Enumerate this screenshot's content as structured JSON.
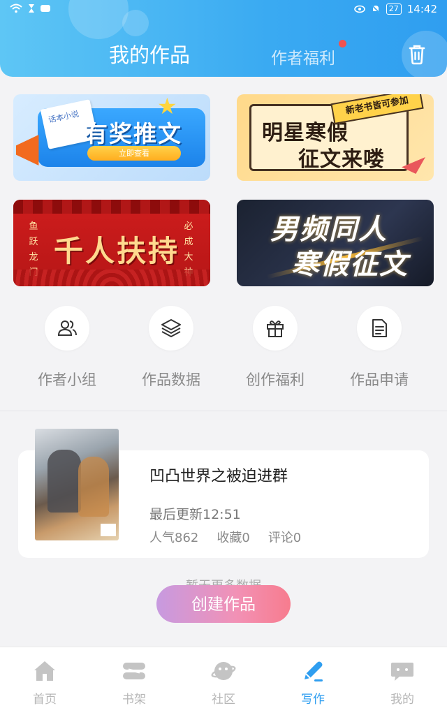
{
  "status_bar": {
    "battery": "27",
    "time": "14:42"
  },
  "header": {
    "tabs": [
      {
        "label": "我的作品",
        "active": true
      },
      {
        "label": "作者福利",
        "active": false,
        "badge_dot": true
      }
    ],
    "trash_icon": "trash-icon"
  },
  "banners": [
    {
      "title": "有奖推文",
      "button": "立即查看",
      "paper_text": "话本小说"
    },
    {
      "title_line1": "明星寒假",
      "title_line2": "征文来喽",
      "tag": "新老书皆可参加"
    },
    {
      "title": "千人扶持",
      "left_text": "鱼跃龙门",
      "right_text": "必成大神"
    },
    {
      "title_line1": "男频同人",
      "title_line2": "寒假征文"
    }
  ],
  "quick_menu": [
    {
      "label": "作者小组",
      "icon": "users-icon"
    },
    {
      "label": "作品数据",
      "icon": "layers-icon"
    },
    {
      "label": "创作福利",
      "icon": "gift-icon"
    },
    {
      "label": "作品申请",
      "icon": "document-icon"
    }
  ],
  "work": {
    "title": "凹凸世界之被迫进群",
    "last_update": "最后更新12:51",
    "popularity": "人气862",
    "favorites": "收藏0",
    "comments": "评论0"
  },
  "no_more_text": "暂无更多数据",
  "create_button": "创建作品",
  "bottom_nav": [
    {
      "label": "首页",
      "icon": "home-icon",
      "active": false
    },
    {
      "label": "书架",
      "icon": "bookshelf-icon",
      "active": false
    },
    {
      "label": "社区",
      "icon": "planet-icon",
      "active": false
    },
    {
      "label": "写作",
      "icon": "pen-icon",
      "active": true
    },
    {
      "label": "我的",
      "icon": "chat-bubble-icon",
      "active": false
    }
  ],
  "colors": {
    "accent": "#2f9ef0",
    "header_gradient_start": "#5ec6f5",
    "create_gradient_end": "#f77c8e",
    "badge": "#f0524f"
  }
}
